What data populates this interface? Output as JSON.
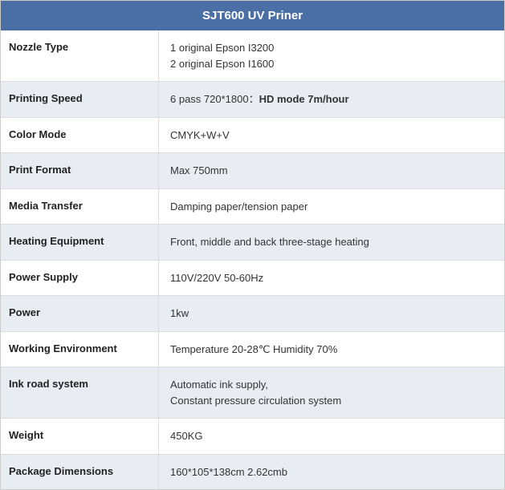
{
  "header": {
    "title": "SJT600 UV Priner"
  },
  "rows": [
    {
      "id": "nozzle-type",
      "label": "Nozzle Type",
      "value": "1 original Epson I3200\n2 original Epson I1600",
      "bold_suffix": null,
      "alt": false
    },
    {
      "id": "printing-speed",
      "label": "Printing Speed",
      "value": "6 pass 720*1800：",
      "bold_suffix": "HD mode 7m/hour",
      "alt": true
    },
    {
      "id": "color-mode",
      "label": "Color Mode",
      "value": "CMYK+W+V",
      "bold_suffix": null,
      "alt": false
    },
    {
      "id": "print-format",
      "label": "Print Format",
      "value": "Max 750mm",
      "bold_suffix": null,
      "alt": true
    },
    {
      "id": "media-transfer",
      "label": "Media Transfer",
      "value": "Damping paper/tension paper",
      "bold_suffix": null,
      "alt": false
    },
    {
      "id": "heating-equipment",
      "label": "Heating Equipment",
      "value": "Front, middle and back three-stage heating",
      "bold_suffix": null,
      "alt": true
    },
    {
      "id": "power-supply",
      "label": "Power Supply",
      "value": "110V/220V 50-60Hz",
      "bold_suffix": null,
      "alt": false
    },
    {
      "id": "power",
      "label": "Power",
      "value": "1kw",
      "bold_suffix": null,
      "alt": true
    },
    {
      "id": "working-environment",
      "label": "Working Environment",
      "value": "Temperature 20-28℃ Humidity 70%",
      "bold_suffix": null,
      "alt": false
    },
    {
      "id": "ink-road-system",
      "label": "Ink road system",
      "value": "Automatic ink supply,\nConstant pressure circulation system",
      "bold_suffix": null,
      "alt": true
    },
    {
      "id": "weight",
      "label": "Weight",
      "value": "450KG",
      "bold_suffix": null,
      "alt": false
    },
    {
      "id": "package-dimensions",
      "label": "Package Dimensions",
      "value": "160*105*138cm 2.62cmb",
      "bold_suffix": null,
      "alt": true
    }
  ]
}
